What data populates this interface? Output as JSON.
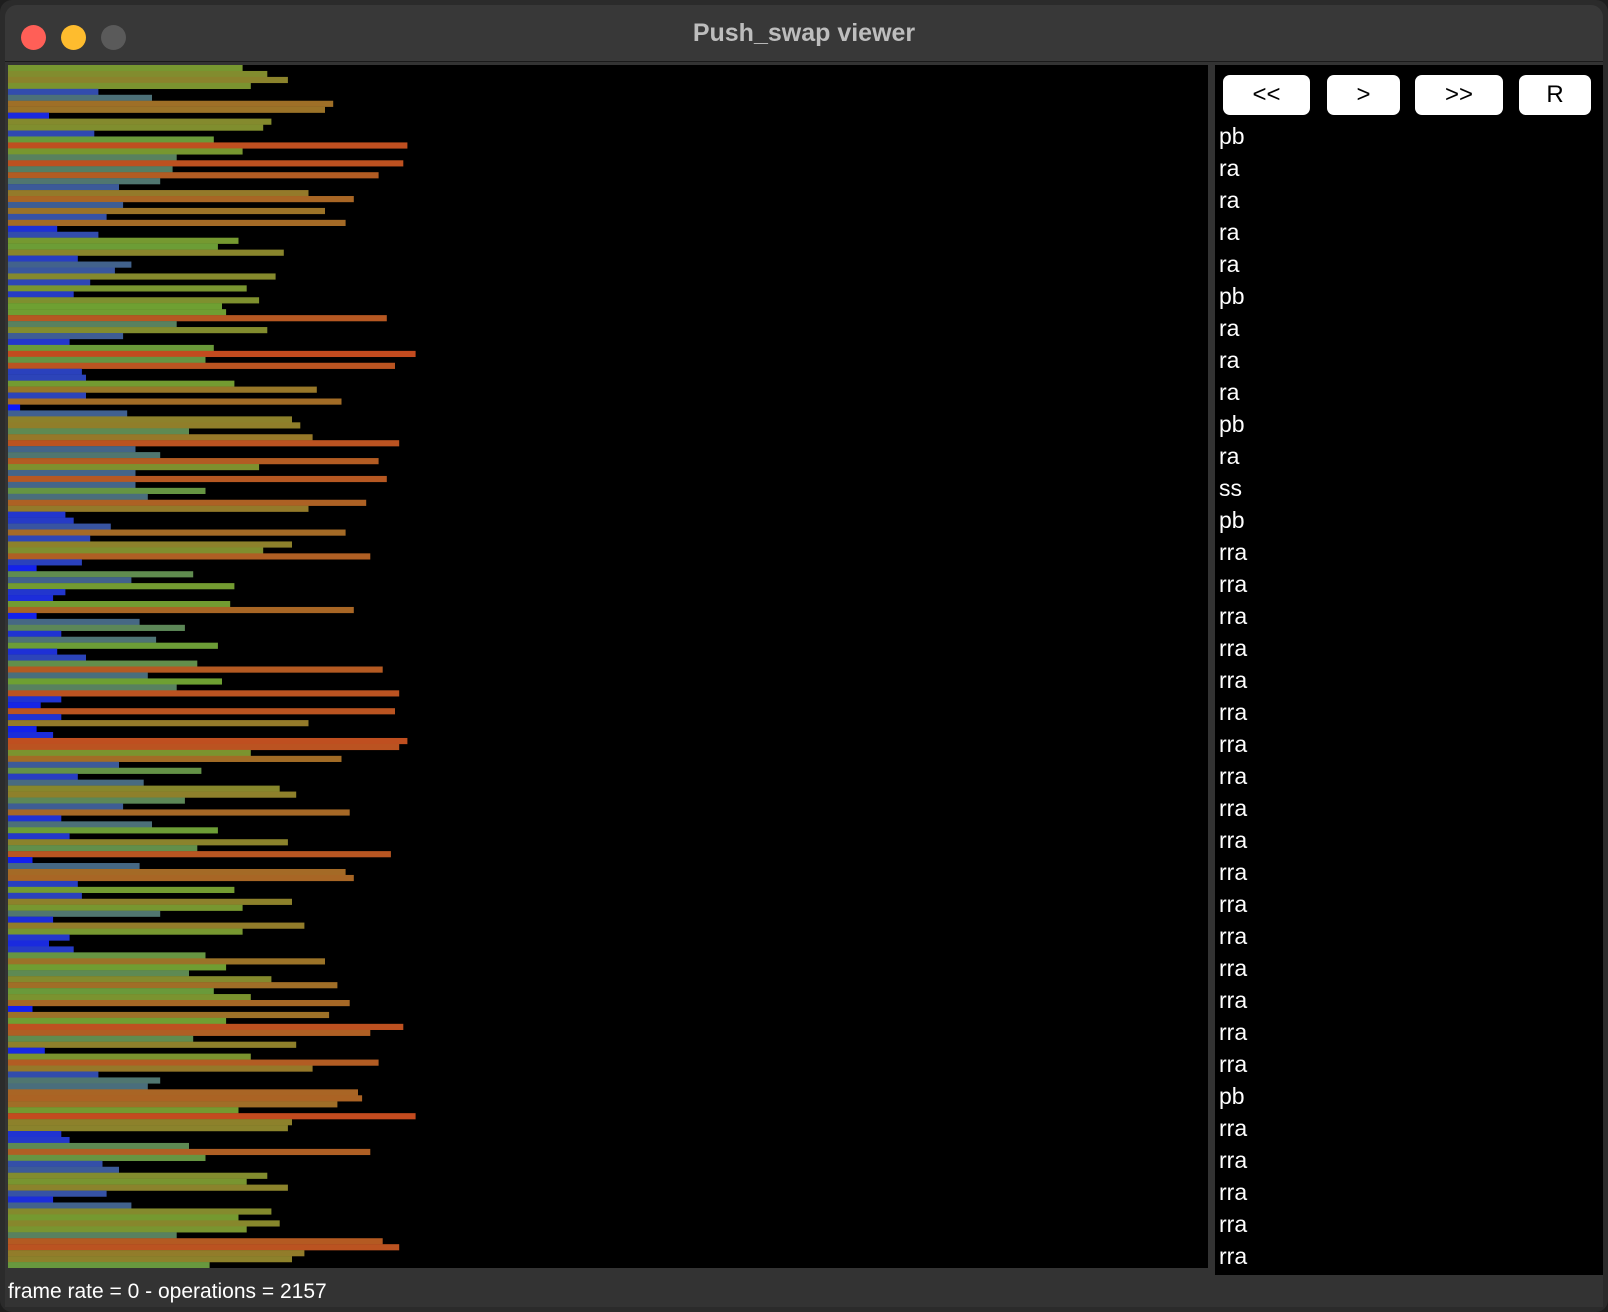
{
  "window": {
    "title": "Push_swap viewer"
  },
  "controls": {
    "rewind_label": "<<",
    "play_label": ">",
    "fast_forward_label": ">>",
    "reset_label": "R"
  },
  "operations": [
    "pb",
    "ra",
    "ra",
    "ra",
    "ra",
    "pb",
    "ra",
    "ra",
    "ra",
    "pb",
    "ra",
    "ss",
    "pb",
    "rra",
    "rra",
    "rra",
    "rra",
    "rra",
    "rra",
    "rra",
    "rra",
    "rra",
    "rra",
    "rra",
    "rra",
    "rra",
    "rra",
    "rra",
    "rra",
    "rra",
    "pb",
    "rra",
    "rra",
    "rra",
    "rra",
    "rra"
  ],
  "status": {
    "text": "frame rate = 0  - operations = 2157"
  },
  "stack_a": {
    "values": [
      0.55,
      0.61,
      0.66,
      0.57,
      0.2,
      0.33,
      0.77,
      0.75,
      0.08,
      0.62,
      0.6,
      0.19,
      0.48,
      0.95,
      0.55,
      0.39,
      0.94,
      0.38,
      0.88,
      0.35,
      0.25,
      0.71,
      0.82,
      0.26,
      0.75,
      0.22,
      0.8,
      0.1,
      0.2,
      0.54,
      0.49,
      0.65,
      0.15,
      0.28,
      0.24,
      0.63,
      0.18,
      0.56,
      0.14,
      0.59,
      0.5,
      0.51,
      0.9,
      0.39,
      0.61,
      0.26,
      0.13,
      0.48,
      0.97,
      0.46,
      0.92,
      0.16,
      0.17,
      0.53,
      0.73,
      0.17,
      0.79,
      0.01,
      0.27,
      0.67,
      0.69,
      0.42,
      0.72,
      0.93,
      0.29,
      0.35,
      0.88,
      0.59,
      0.29,
      0.9,
      0.29,
      0.46,
      0.32,
      0.85,
      0.71,
      0.12,
      0.14,
      0.23,
      0.8,
      0.18,
      0.67,
      0.6,
      0.86,
      0.16,
      0.05,
      0.43,
      0.28,
      0.53,
      0.12,
      0.09,
      0.52,
      0.82,
      0.05,
      0.3,
      0.41,
      0.11,
      0.34,
      0.49,
      0.1,
      0.17,
      0.44,
      0.89,
      0.32,
      0.5,
      0.39,
      0.93,
      0.11,
      0.06,
      0.92,
      0.11,
      0.71,
      0.05,
      0.09,
      0.95,
      0.93,
      0.57,
      0.79,
      0.25,
      0.45,
      0.15,
      0.31,
      0.64,
      0.68,
      0.41,
      0.26,
      0.81,
      0.11,
      0.33,
      0.49,
      0.13,
      0.66,
      0.44,
      0.91,
      0.04,
      0.3,
      0.8,
      0.82,
      0.15,
      0.53,
      0.16,
      0.67,
      0.55,
      0.35,
      0.09,
      0.7,
      0.55,
      0.13,
      0.08,
      0.14,
      0.46,
      0.75,
      0.51,
      0.42,
      0.62,
      0.78,
      0.48,
      0.57,
      0.81,
      0.04,
      0.76,
      0.51,
      0.94,
      0.86,
      0.43,
      0.68,
      0.07,
      0.57,
      0.88,
      0.72,
      0.2,
      0.35,
      0.32,
      0.83,
      0.84,
      0.78,
      0.54,
      0.97,
      0.67,
      0.66,
      0.11,
      0.13,
      0.42,
      0.86,
      0.46,
      0.21,
      0.25,
      0.61,
      0.56,
      0.66,
      0.22,
      0.09,
      0.28,
      0.62,
      0.54,
      0.64,
      0.56,
      0.39,
      0.89,
      0.93,
      0.7,
      0.67,
      0.47
    ]
  },
  "colors": {
    "low": "#0a14ff",
    "mid": "#6ea032",
    "high": "#c8461e",
    "background": "#000000"
  }
}
